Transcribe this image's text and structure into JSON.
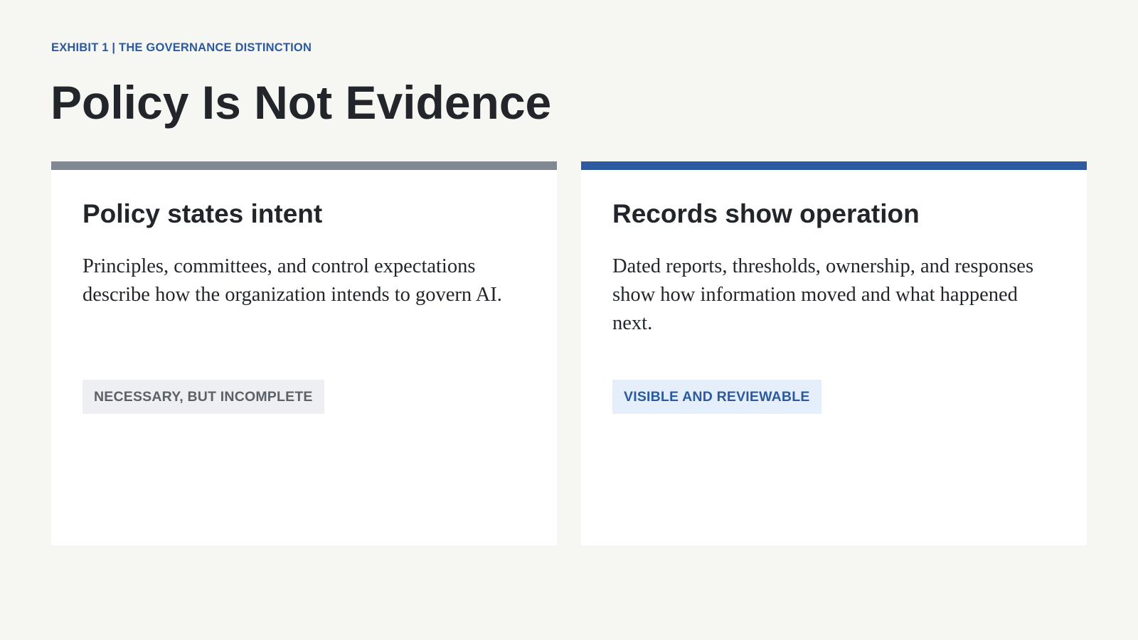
{
  "header": {
    "eyebrow": "EXHIBIT 1 | THE GOVERNANCE DISTINCTION",
    "title": "Policy Is Not Evidence"
  },
  "cards": [
    {
      "heading": "Policy states intent",
      "body": "Principles, committees, and control expectations describe how the organization intends to govern AI.",
      "tag": "NECESSARY, BUT INCOMPLETE",
      "bar_color": "#818891"
    },
    {
      "heading": "Records show operation",
      "body": "Dated reports, thresholds, ownership, and responses show how information moved and what happened next.",
      "tag": "VISIBLE AND REVIEWABLE",
      "bar_color": "#2d5aa0"
    }
  ],
  "colors": {
    "accent": "#2c5aa0",
    "neutral": "#818891",
    "background": "#f6f6f3",
    "text": "#22262b"
  }
}
